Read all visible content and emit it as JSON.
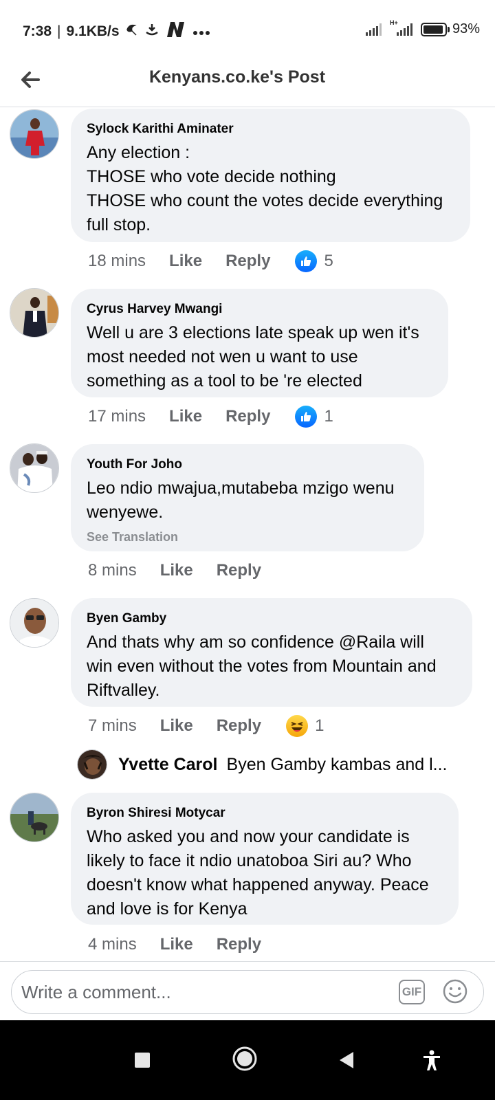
{
  "status_bar": {
    "time": "7:38",
    "separator": "|",
    "net_speed": "9.1KB/s",
    "network_type": "H+",
    "battery": "93%",
    "battery_level": 0.93
  },
  "header": {
    "title": "Kenyans.co.ke's Post"
  },
  "comments": [
    {
      "author": "Sylock Karithi Aminater",
      "text": "Any election :\nTHOSE who vote decide nothing\nTHOSE who count the votes decide everything\nfull stop.",
      "time": "18 mins",
      "like_label": "Like",
      "reply_label": "Reply",
      "reaction_count": "5",
      "reaction_icon": "like-icon"
    },
    {
      "author": "Cyrus Harvey Mwangi",
      "text": "Well u are 3 elections late speak up wen it's\nmost needed not wen u want to use\nsomething as a tool to be 're elected",
      "time": "17 mins",
      "like_label": "Like",
      "reply_label": "Reply",
      "reaction_count": "1",
      "reaction_icon": "like-icon"
    },
    {
      "author": "Youth For Joho",
      "text": "Leo ndio mwajua,mutabeba mzigo wenu\nwenyewe.",
      "see_translation": "See Translation",
      "time": "8 mins",
      "like_label": "Like",
      "reply_label": "Reply"
    },
    {
      "author": "Byen Gamby",
      "text": "And thats why am so confidence @Raila will\nwin even without the votes from Mountain and\nRiftvalley.",
      "time": "7 mins",
      "like_label": "Like",
      "reply_label": "Reply",
      "reaction_count": "1",
      "reaction_icon": "haha-icon"
    },
    {
      "author": "Byron Shiresi Motycar",
      "text": "Who asked you and now your candidate is\nlikely to face it ndio unatoboa Siri au? Who\ndoesn't know what happened anyway. Peace\nand love is for Kenya",
      "time": "4 mins",
      "like_label": "Like",
      "reply_label": "Reply"
    }
  ],
  "reply_preview": {
    "author": "Yvette Carol",
    "text": "Byen Gamby kambas and l..."
  },
  "composer": {
    "placeholder": "Write a comment...",
    "gif_label": "GIF"
  },
  "colors": {
    "bubble": "#f0f2f5",
    "secondary_text": "#65676b",
    "like_blue": "#1877f2",
    "navbar": "#000000"
  }
}
